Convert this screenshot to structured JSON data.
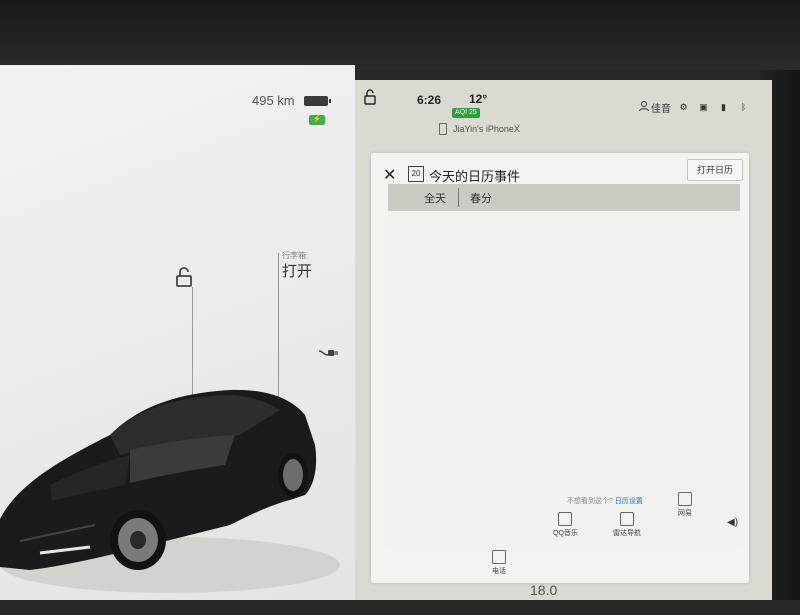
{
  "car_panel": {
    "range": "495 km",
    "trunk_label": "行李箱",
    "trunk_state": "打开"
  },
  "status_bar": {
    "time": "6:26",
    "temperature": "12°",
    "aqi": "AQI 25",
    "user_name": "佳音"
  },
  "phone": {
    "device_name": "JiaYin's iPhoneX"
  },
  "calendar_dialog": {
    "title": "今天的日历事件",
    "calendar_icon_day": "20",
    "open_button": "打开日历",
    "events": [
      {
        "time": "全天",
        "name": "春分"
      }
    ],
    "footer_text": "不想看到这个?",
    "footer_link": "日历设置"
  },
  "dock": {
    "items": [
      {
        "label": "QQ音乐"
      },
      {
        "label": "雷达导航"
      },
      {
        "label": "网易"
      },
      {
        "label": "电话"
      }
    ],
    "cabin_temp": "18.0"
  },
  "colors": {
    "accent_green": "#2e9f3a",
    "link_blue": "#2a6fd6"
  }
}
